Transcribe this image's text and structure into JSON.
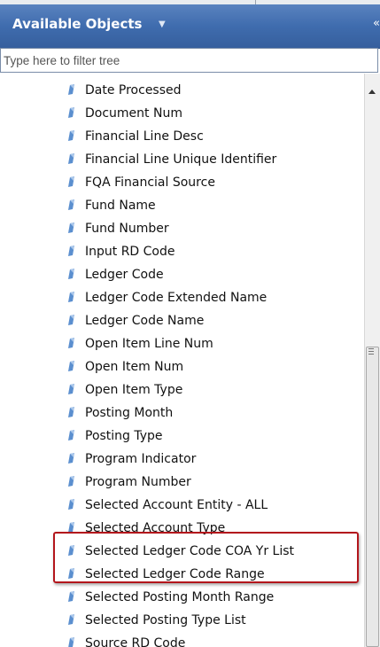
{
  "header": {
    "title": "Available Objects",
    "caret_icon": "caret-down-icon",
    "collapse_icon": "double-chevron-left-icon"
  },
  "filter": {
    "placeholder": "Type here to filter tree",
    "value": ""
  },
  "tree": {
    "item_icon": "dimension-object-icon",
    "items": [
      {
        "label": "Date Processed"
      },
      {
        "label": "Document Num"
      },
      {
        "label": "Financial Line Desc"
      },
      {
        "label": "Financial Line Unique Identifier"
      },
      {
        "label": "FQA Financial Source"
      },
      {
        "label": "Fund Name"
      },
      {
        "label": "Fund Number"
      },
      {
        "label": "Input RD Code"
      },
      {
        "label": "Ledger Code"
      },
      {
        "label": "Ledger Code Extended Name"
      },
      {
        "label": "Ledger Code Name"
      },
      {
        "label": "Open Item Line Num"
      },
      {
        "label": "Open Item Num"
      },
      {
        "label": "Open Item Type"
      },
      {
        "label": "Posting Month"
      },
      {
        "label": "Posting Type"
      },
      {
        "label": "Program Indicator"
      },
      {
        "label": "Program Number"
      },
      {
        "label": "Selected Account Entity - ALL"
      },
      {
        "label": "Selected Account Type"
      },
      {
        "label": "Selected Ledger Code COA Yr List"
      },
      {
        "label": "Selected Ledger Code Range"
      },
      {
        "label": "Selected Posting Month Range"
      },
      {
        "label": "Selected Posting Type List"
      },
      {
        "label": "Source RD Code"
      }
    ]
  },
  "colors": {
    "header": "#3f6cae",
    "highlight_border": "#b3161c",
    "icon": "#5b8fcf"
  }
}
